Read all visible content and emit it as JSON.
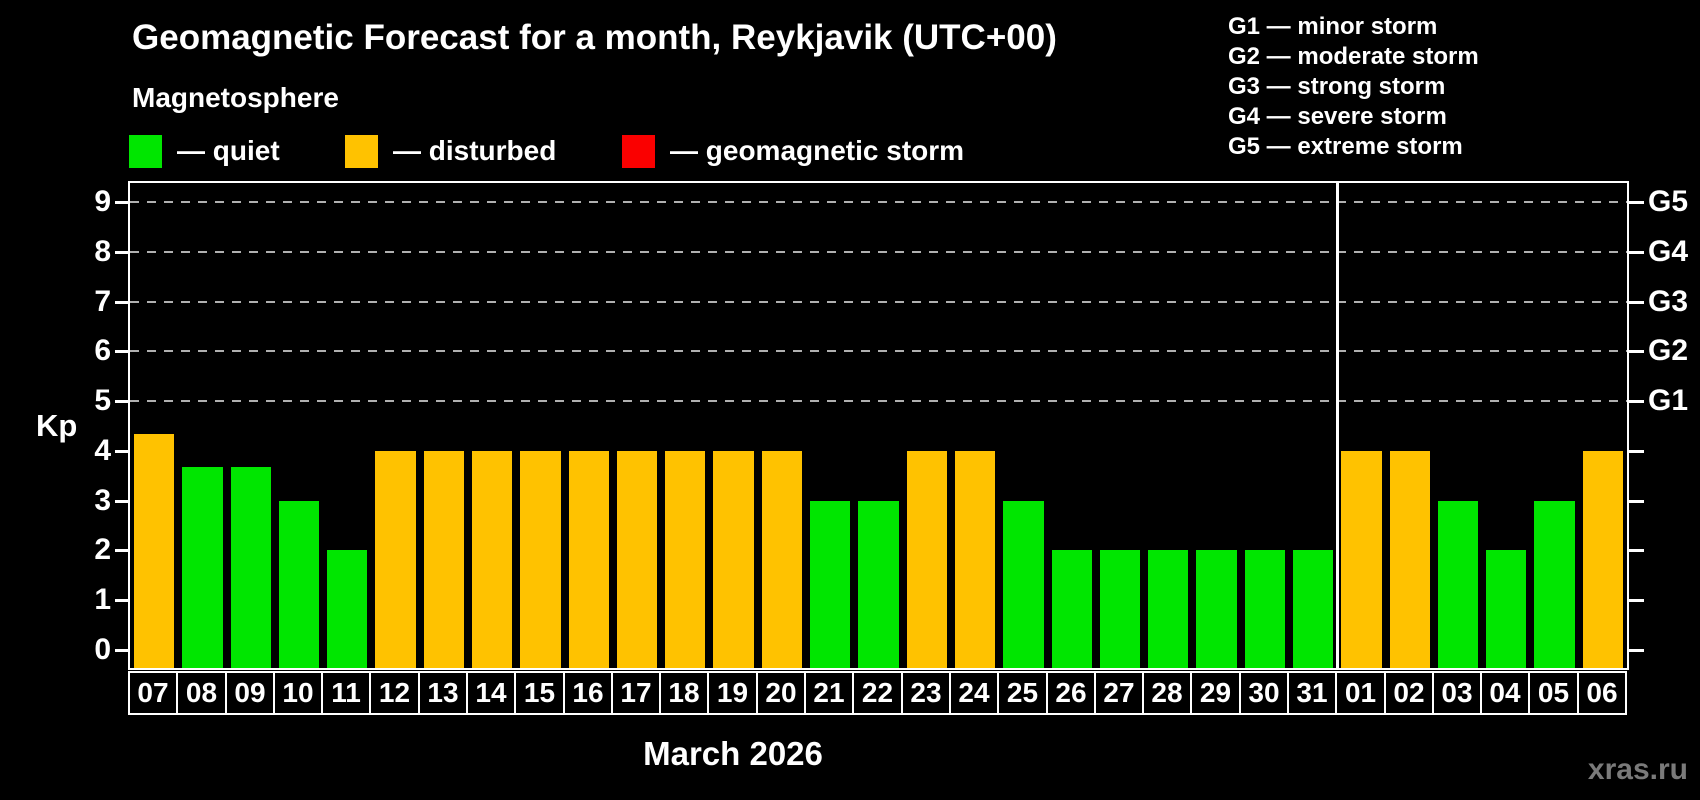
{
  "header": {
    "title": "Geomagnetic Forecast for a month, Reykjavik (UTC+00)",
    "subtitle": "Magnetosphere"
  },
  "legend": {
    "items": [
      {
        "key": "quiet",
        "color": "#00e600",
        "label": "— quiet"
      },
      {
        "key": "disturbed",
        "color": "#ffc200",
        "label": "— disturbed"
      },
      {
        "key": "storm",
        "color": "#fa0000",
        "label": "— geomagnetic storm"
      }
    ]
  },
  "g_scale_legend": {
    "lines": [
      "G1 — minor storm",
      "G2 — moderate storm",
      "G3 — strong storm",
      "G4 — severe storm",
      "G5 — extreme storm"
    ]
  },
  "watermark": "xras.ru",
  "chart_data": {
    "type": "bar",
    "title": "Geomagnetic Forecast for a month, Reykjavik (UTC+00)",
    "subtitle": "Magnetosphere",
    "ylabel": "Kp",
    "xlabel": "March 2026",
    "ylim": [
      0,
      9
    ],
    "yticks": [
      0,
      1,
      2,
      3,
      4,
      5,
      6,
      7,
      8,
      9
    ],
    "gridlines_at": [
      5,
      6,
      7,
      8,
      9
    ],
    "grid": "dashed horizontal at storm levels",
    "legend_position": "top-left",
    "right_axis_labels": [
      {
        "label": "G1",
        "kp": 5
      },
      {
        "label": "G2",
        "kp": 6
      },
      {
        "label": "G3",
        "kp": 7
      },
      {
        "label": "G4",
        "kp": 8
      },
      {
        "label": "G5",
        "kp": 9
      }
    ],
    "categories": [
      "07",
      "08",
      "09",
      "10",
      "11",
      "12",
      "13",
      "14",
      "15",
      "16",
      "17",
      "18",
      "19",
      "20",
      "21",
      "22",
      "23",
      "24",
      "25",
      "26",
      "27",
      "28",
      "29",
      "30",
      "31",
      "01",
      "02",
      "03",
      "04",
      "05",
      "06"
    ],
    "values": [
      4.33,
      3.67,
      3.67,
      3,
      2,
      4,
      4,
      4,
      4,
      4,
      4,
      4,
      4,
      4,
      3,
      3,
      4,
      4,
      3,
      2,
      2,
      2,
      2,
      2,
      2,
      4,
      4,
      3,
      2,
      3,
      4
    ],
    "states": [
      "disturbed",
      "quiet",
      "quiet",
      "quiet",
      "quiet",
      "disturbed",
      "disturbed",
      "disturbed",
      "disturbed",
      "disturbed",
      "disturbed",
      "disturbed",
      "disturbed",
      "disturbed",
      "quiet",
      "quiet",
      "disturbed",
      "disturbed",
      "quiet",
      "quiet",
      "quiet",
      "quiet",
      "quiet",
      "quiet",
      "quiet",
      "disturbed",
      "disturbed",
      "quiet",
      "quiet",
      "quiet",
      "disturbed"
    ],
    "month_separator_after_index": 24,
    "colors": {
      "quiet": "#00e600",
      "disturbed": "#ffc200",
      "storm": "#fa0000"
    }
  }
}
